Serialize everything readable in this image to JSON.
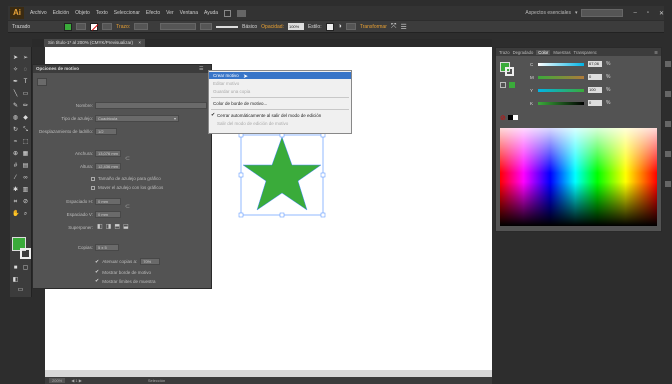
{
  "menubar": {
    "logo": "Ai",
    "items": [
      "Archivo",
      "Edición",
      "Objeto",
      "Texto",
      "Seleccionar",
      "Efecto",
      "Ver",
      "Ventana",
      "Ayuda"
    ],
    "workspace_label": "Aspectos esenciales"
  },
  "controlbar": {
    "object_type": "Trazado",
    "stroke_label": "Trazo:",
    "brush_label": "Básico",
    "opacity_label": "Opacidad:",
    "opacity_value": "100%",
    "style_label": "Estilo:",
    "transform_label": "Transformar"
  },
  "document": {
    "tab_title": "Sin título-1* al 200% (CMYK/Previsualizar)"
  },
  "dialog": {
    "title": "Opciones de motivo",
    "name_label": "Nombre:",
    "tile_type_label": "Tipo de azulejo:",
    "tile_type_value": "Cuadrícula",
    "brick_offset_label": "Desplazamiento de ladrillo:",
    "brick_offset_value": "1/2",
    "width_label": "Anchura:",
    "width_value": "13,076 mm",
    "height_label": "Altura:",
    "height_value": "12,436 mm",
    "size_to_art_label": "Tamaño de azulejo para gráfico",
    "move_tile_label": "Mover el azulejo con los gráficos",
    "h_spacing_label": "Espaciado H:",
    "h_spacing_value": "0 mm",
    "v_spacing_label": "Espaciado V:",
    "v_spacing_value": "0 mm",
    "overlap_label": "Superponer:",
    "copies_label": "Copias:",
    "copies_value": "5 x 5",
    "dim_copies_label": "Atenuar copias a:",
    "dim_copies_value": "70%",
    "show_tile_edge_label": "Mostrar borde de motivo",
    "show_swatch_bounds_label": "Mostrar límites de muestra"
  },
  "flyout": {
    "items": [
      {
        "label": "Crear motivo",
        "state": "highlighted"
      },
      {
        "label": "Editar motivo",
        "state": "disabled"
      },
      {
        "label": "Guardar una copia",
        "state": "disabled"
      },
      {
        "label": "Color de borde de motivo...",
        "state": "enabled"
      },
      {
        "label": "Cerrar automáticamente al salir del modo de edición",
        "state": "checked"
      },
      {
        "label": "Salir del modo de edición de motivo",
        "state": "disabled"
      }
    ]
  },
  "color_panel": {
    "tabs": [
      "Trazo",
      "Degradado",
      "Color",
      "Muestras",
      "Transparenc"
    ],
    "active_tab": "Color",
    "channels": [
      {
        "label": "C",
        "value": "67,06",
        "color": "#00b4e6"
      },
      {
        "label": "M",
        "value": "0",
        "color": "#e6008c"
      },
      {
        "label": "Y",
        "value": "100",
        "color": "#f0e600"
      },
      {
        "label": "K",
        "value": "0",
        "color": "#222222"
      }
    ],
    "percent": "%"
  },
  "colors": {
    "star_fill": "#3aab3a",
    "selection": "#4a8cff",
    "accent": "#3875c8"
  },
  "status": {
    "zoom": "200%",
    "tool": "Selección"
  }
}
